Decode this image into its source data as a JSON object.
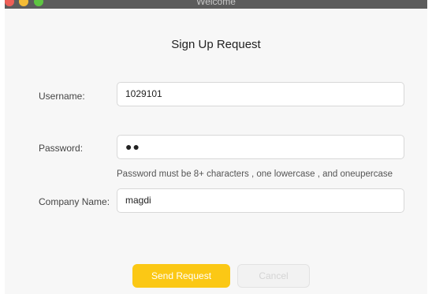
{
  "window": {
    "title": "Welcome"
  },
  "form": {
    "title": "Sign Up Request",
    "username": {
      "label": "Username:",
      "value": "1029101"
    },
    "password": {
      "label": "Password:",
      "masked_value": "●●",
      "hint": "Password must be 8+ characters , one lowercase , and oneupercase"
    },
    "company": {
      "label": "Company Name:",
      "value": "magdi"
    }
  },
  "buttons": {
    "send_label": "Send Request",
    "cancel_label": "Cancel"
  },
  "colors": {
    "accent": "#fbc815",
    "titlebar": "#5c5c5c",
    "background": "#f7f7f7"
  }
}
